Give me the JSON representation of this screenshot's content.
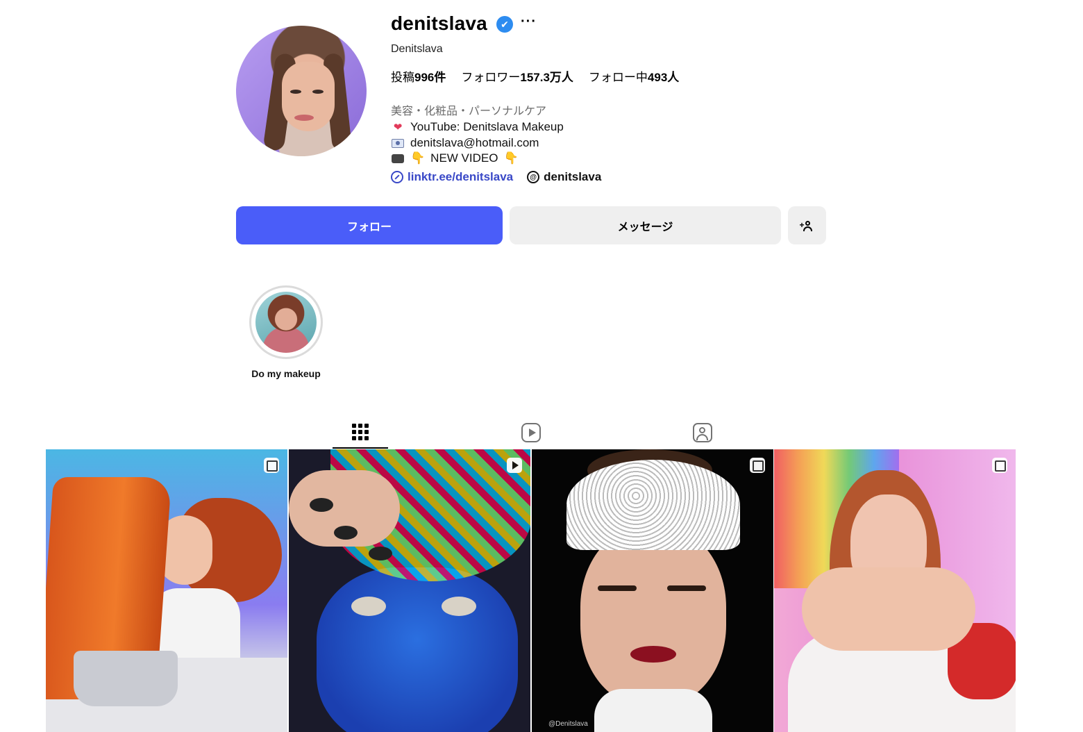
{
  "profile": {
    "username": "denitslava",
    "verified_mark": "✔",
    "more_label": "···",
    "full_name": "Denitslava",
    "stats": {
      "posts_label": "投稿",
      "posts_value": "996件",
      "followers_label": "フォロワー",
      "followers_value": "157.3万人",
      "following_label": "フォロー中",
      "following_value": "493人"
    },
    "category": "美容・化粧品・パーソナルケア",
    "bio": {
      "line1": "YouTube: Denitslava Makeup",
      "line2": "denitslava@hotmail.com",
      "line3": "NEW VIDEO"
    },
    "link_text": "linktr.ee/denitslava",
    "threads_handle": "denitslava"
  },
  "actions": {
    "follow_label": "フォロー",
    "message_label": "メッセージ",
    "add_icon": "add-person-icon"
  },
  "highlights": [
    {
      "label": "Do my makeup"
    }
  ],
  "tabs": [
    {
      "icon": "grid-icon",
      "active": true
    },
    {
      "icon": "reels-icon",
      "active": false
    },
    {
      "icon": "tagged-icon",
      "active": false
    }
  ],
  "posts": [
    {
      "type": "carousel",
      "badge_icon": "carousel-icon"
    },
    {
      "type": "reel",
      "badge_icon": "reel-icon"
    },
    {
      "type": "carousel",
      "badge_icon": "carousel-icon",
      "watermark": "@Denitslava"
    },
    {
      "type": "carousel",
      "badge_icon": "carousel-icon"
    }
  ],
  "colors": {
    "follow_button": "#4a5df9",
    "link": "#3948c7",
    "verified": "#2d8cf0"
  }
}
